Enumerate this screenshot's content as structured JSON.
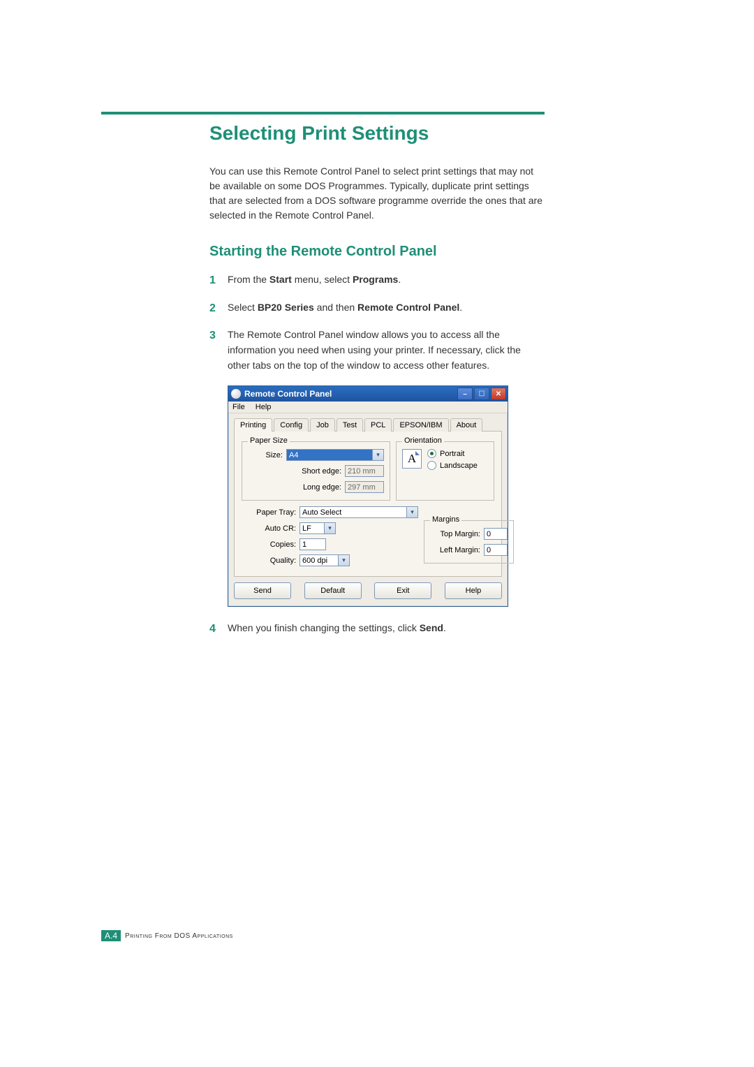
{
  "heading": "Selecting Print Settings",
  "intro": "You can use this Remote Control Panel to select print settings that may not be available on some DOS Programmes. Typically, duplicate print settings that are selected from a DOS software programme override the ones that are selected in the Remote Control Panel.",
  "subheading": "Starting the Remote Control Panel",
  "steps": {
    "s1": {
      "pre": "From the ",
      "b1": "Start",
      "mid": " menu, select ",
      "b2": "Programs",
      "post": "."
    },
    "s2": {
      "pre": "Select ",
      "b1": "BP20 Series",
      "mid": " and then ",
      "b2": "Remote Control Panel",
      "post": "."
    },
    "s3": "The Remote Control Panel window allows you to access all the information you need when using your printer. If necessary, click the other tabs on the top of the window to access other features.",
    "s4": {
      "pre": "When you finish changing the settings, click ",
      "b1": "Send",
      "post": "."
    }
  },
  "dialog": {
    "title": "Remote Control Panel",
    "menu": {
      "file": "File",
      "help": "Help"
    },
    "tabs": [
      "Printing",
      "Config",
      "Job",
      "Test",
      "PCL",
      "EPSON/IBM",
      "About"
    ],
    "paperSize": {
      "legend": "Paper Size",
      "sizeLabel": "Size:",
      "sizeValue": "A4",
      "shortLabel": "Short edge:",
      "shortValue": "210 mm",
      "longLabel": "Long edge:",
      "longValue": "297 mm"
    },
    "orientation": {
      "legend": "Orientation",
      "iconLetter": "A",
      "portrait": "Portrait",
      "landscape": "Landscape"
    },
    "trayLabel": "Paper Tray:",
    "trayValue": "Auto Select",
    "autocrLabel": "Auto CR:",
    "autocrValue": "LF",
    "copiesLabel": "Copies:",
    "copiesValue": "1",
    "qualityLabel": "Quality:",
    "qualityValue": "600 dpi",
    "margins": {
      "legend": "Margins",
      "topLabel": "Top Margin:",
      "topValue": "0",
      "leftLabel": "Left Margin:",
      "leftValue": "0"
    },
    "buttons": {
      "send": "Send",
      "def": "Default",
      "exit": "Exit",
      "help": "Help"
    }
  },
  "footer": {
    "section": "A.",
    "page": "4",
    "text": "Printing From DOS Applications"
  }
}
